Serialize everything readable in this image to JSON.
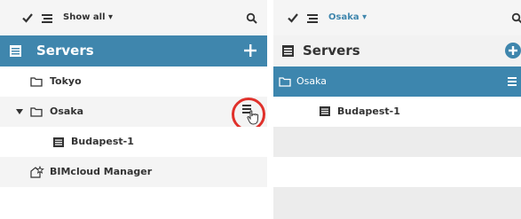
{
  "left": {
    "toolbar": {
      "filter_label": "Show all ▾"
    },
    "header": {
      "title": "Servers"
    },
    "rows": [
      {
        "label": "Tokyo"
      },
      {
        "label": "Osaka"
      },
      {
        "label": "Budapest-1"
      },
      {
        "label": "BIMcloud Manager"
      }
    ]
  },
  "right": {
    "toolbar": {
      "filter_label": "Osaka ▾"
    },
    "header": {
      "title": "Servers"
    },
    "rows": [
      {
        "label": "Osaka"
      },
      {
        "label": "Budapest-1"
      }
    ]
  },
  "colors": {
    "accent": "#3f86ad",
    "highlight_ring": "#e0312b"
  }
}
